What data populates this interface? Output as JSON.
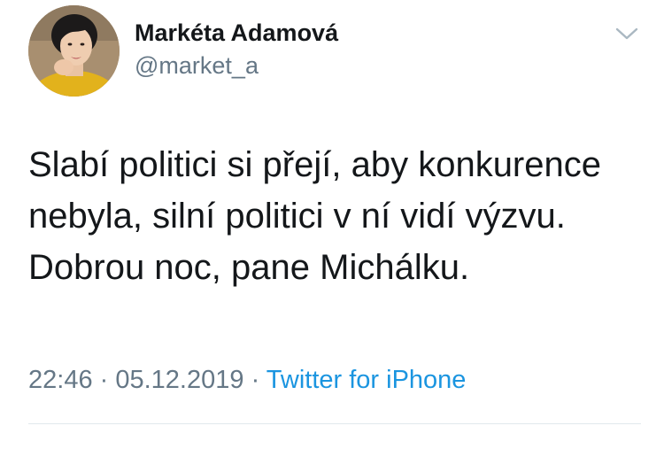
{
  "tweet": {
    "author": {
      "name": "Markéta Adamová",
      "handle": "@market_a"
    },
    "text_lines": [
      "Slabí politici si přejí, aby konkurence",
      "nebyla, silní politici v ní vidí výzvu.",
      "Dobrou noc, pane Michálku."
    ],
    "time": "22:46",
    "separator": " · ",
    "date": "05.12.2019",
    "source": "Twitter for iPhone"
  },
  "icons": {
    "menu": "chevron-down-icon",
    "avatar": "avatar"
  },
  "colors": {
    "name": "#14171a",
    "secondary_text": "#657786",
    "link": "#1b95e0",
    "divider": "#e1e8ed"
  }
}
